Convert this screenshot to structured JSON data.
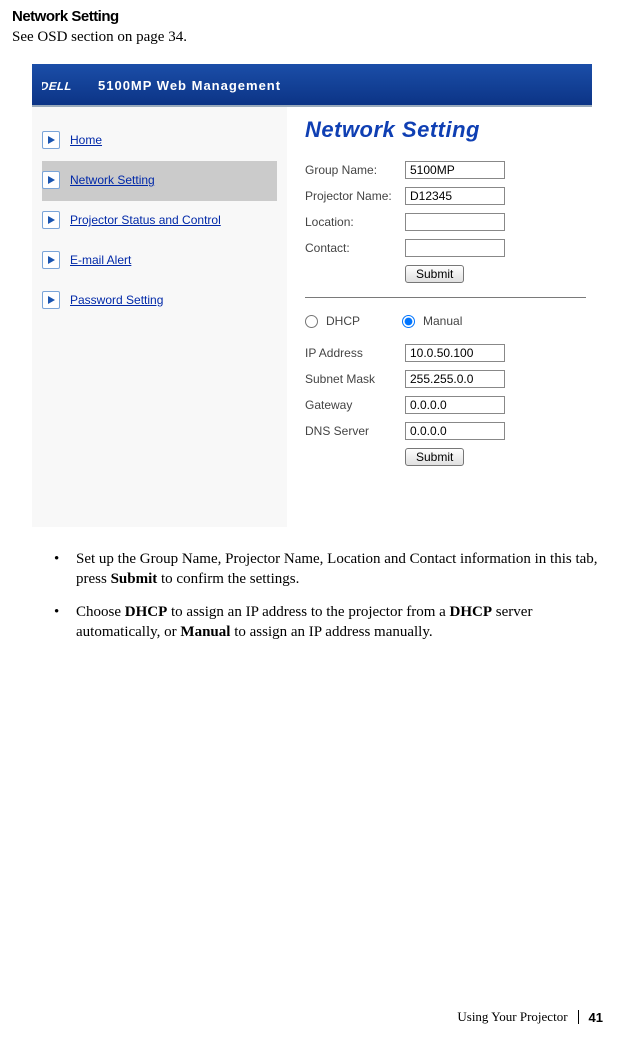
{
  "heading": "Network Setting",
  "subheading": "See OSD section on page 34.",
  "header": {
    "brand_text": "DELL",
    "title": "5100MP Web Management"
  },
  "sidebar": {
    "items": [
      {
        "label": "Home"
      },
      {
        "label": "Network Setting"
      },
      {
        "label": "Projector Status and Control"
      },
      {
        "label": "E-mail Alert"
      },
      {
        "label": "Password Setting"
      }
    ]
  },
  "main": {
    "title": "Network Setting",
    "group1": {
      "group_name_label": "Group Name:",
      "group_name_value": "5100MP",
      "projector_name_label": "Projector Name:",
      "projector_name_value": "D12345",
      "location_label": "Location:",
      "location_value": "",
      "contact_label": "Contact:",
      "contact_value": "",
      "submit_label": "Submit"
    },
    "radio": {
      "dhcp_label": "DHCP",
      "manual_label": "Manual"
    },
    "group2": {
      "ip_label": "IP Address",
      "ip_value": "10.0.50.100",
      "subnet_label": "Subnet Mask",
      "subnet_value": "255.255.0.0",
      "gateway_label": "Gateway",
      "gateway_value": "0.0.0.0",
      "dns_label": "DNS Server",
      "dns_value": "0.0.0.0",
      "submit_label": "Submit"
    }
  },
  "bullets": {
    "b1_pre": "Set up the Group Name, Projector Name, Location and Contact information in this tab, press ",
    "b1_bold": "Submit",
    "b1_post": " to confirm the settings.",
    "b2_pre": "Choose ",
    "b2_bold1": "DHCP",
    "b2_mid1": " to assign an IP address to the projector from a ",
    "b2_bold2": "DHCP",
    "b2_mid2": " server automatically, or ",
    "b2_bold3": "Manual",
    "b2_post": " to assign an IP address manually."
  },
  "footer": {
    "section": "Using Your Projector",
    "page": "41"
  }
}
